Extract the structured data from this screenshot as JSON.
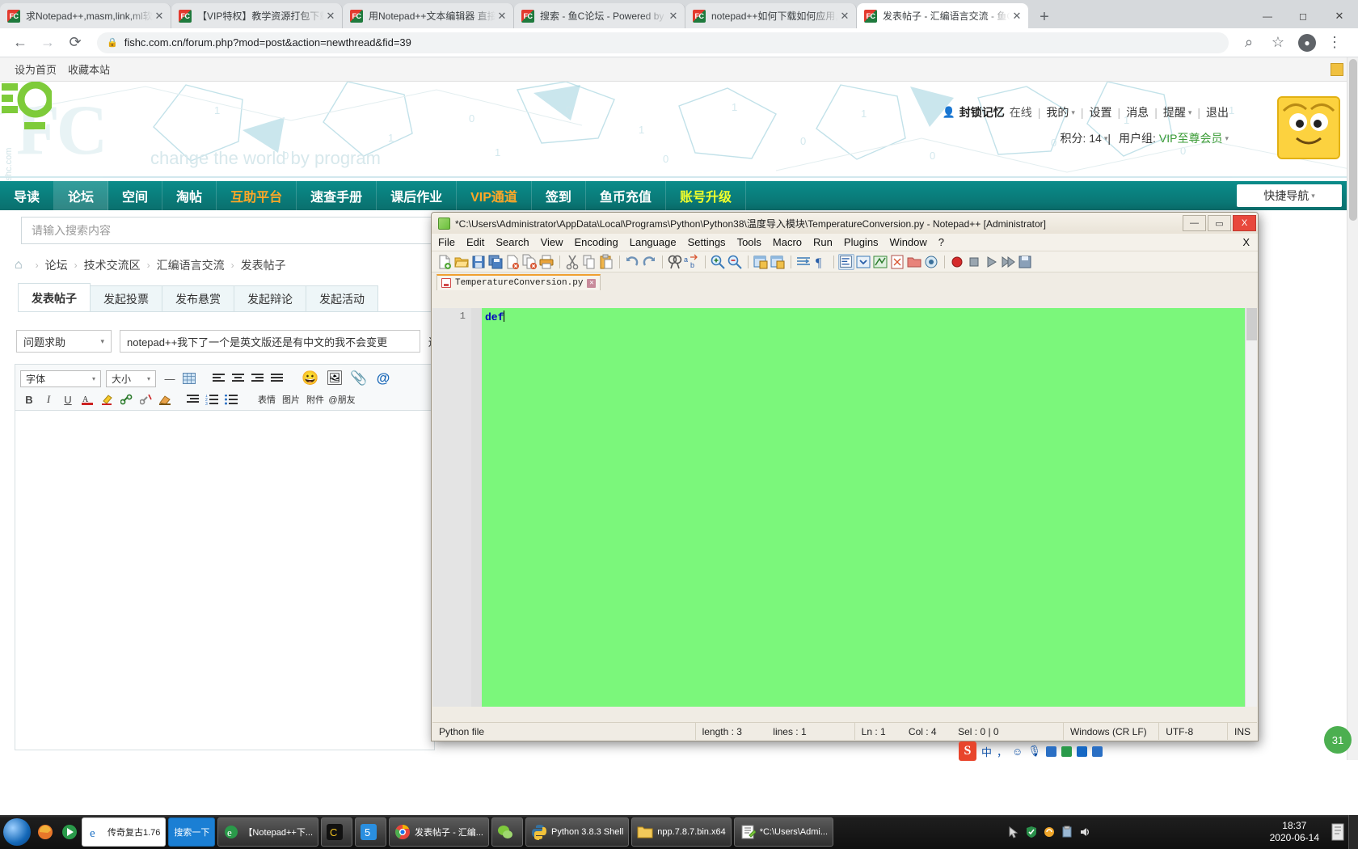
{
  "browser": {
    "tabs": [
      {
        "title": "求Notepad++,masm,link,ml软",
        "active": false
      },
      {
        "title": "【VIP特权】教学资源打包下载地",
        "active": false
      },
      {
        "title": "用Notepad++文本编辑器 直接",
        "active": false
      },
      {
        "title": "搜索 - 鱼C论坛 - Powered by D",
        "active": false
      },
      {
        "title": "notepad++如何下载如何应用,新",
        "active": false
      },
      {
        "title": "发表帖子 - 汇编语言交流 - 鱼C论",
        "active": true
      }
    ],
    "favicon_text": "FC",
    "new_tab_label": "+",
    "close_label": "✕",
    "back_icon": "←",
    "forward_icon": "→",
    "reload_icon": "⟳",
    "lock_icon": "🔒",
    "url": "fishc.com.cn/forum.php?mod=post&action=newthread&fid=39",
    "zoom_icon": "⌕",
    "star_icon": "☆",
    "profile_icon": "👤",
    "menu_icon": "⋮",
    "window_min": "—",
    "window_max": "◻",
    "window_close": "✕"
  },
  "site": {
    "topbar": {
      "set_home": "设为首页",
      "bookmark": "收藏本站"
    },
    "logo": {
      "mark": "FC",
      "tagline": "change the world by program",
      "side_text": "fishc.com"
    },
    "user": {
      "person_icon": "👤",
      "name": "封锁记忆",
      "status": "在线",
      "mine": "我的",
      "settings": "设置",
      "messages": "消息",
      "notices": "提醒",
      "logout": "退出",
      "points_label": "积分: 14",
      "group_label": "用户组:",
      "group_value": "VIP至尊会员"
    },
    "nav": [
      {
        "label": "导读",
        "style": "plain",
        "active": false
      },
      {
        "label": "论坛",
        "style": "plain",
        "active": true
      },
      {
        "label": "空间",
        "style": "plain",
        "active": false
      },
      {
        "label": "淘帖",
        "style": "plain",
        "active": false
      },
      {
        "label": "互助平台",
        "style": "orange",
        "active": false
      },
      {
        "label": "速查手册",
        "style": "plain",
        "active": false
      },
      {
        "label": "课后作业",
        "style": "plain",
        "active": false
      },
      {
        "label": "VIP通道",
        "style": "orange",
        "active": false
      },
      {
        "label": "签到",
        "style": "plain",
        "active": false
      },
      {
        "label": "鱼币充值",
        "style": "plain",
        "active": false
      },
      {
        "label": "账号升级",
        "style": "yellow",
        "active": false
      }
    ],
    "quicknav": "快捷导航",
    "search_placeholder": "请输入搜索内容",
    "search_value": "",
    "breadcrumb": {
      "home_icon": "⌂",
      "items": [
        "论坛",
        "技术交流区",
        "汇编语言交流",
        "发表帖子"
      ],
      "separator": "›"
    },
    "post_tabs": [
      {
        "label": "发表帖子",
        "active": true
      },
      {
        "label": "发起投票",
        "active": false
      },
      {
        "label": "发布悬赏",
        "active": false
      },
      {
        "label": "发起辩论",
        "active": false
      },
      {
        "label": "发起活动",
        "active": false
      }
    ],
    "title_row": {
      "category": "问题求助",
      "title_value": "notepad++我下了一个是英文版还是有中文的我不会变更",
      "trailing": "还"
    },
    "editor_toolbar": {
      "font_label": "字体",
      "size_label": "大小",
      "buttons": [
        {
          "name": "bold",
          "glyph": "B"
        },
        {
          "name": "italic",
          "glyph": "I"
        },
        {
          "name": "underline",
          "glyph": "U"
        }
      ],
      "icons": [
        {
          "name": "smile-icon",
          "glyph": "😀",
          "label": "表情"
        },
        {
          "name": "image-icon",
          "glyph": "🖼",
          "label": "图片"
        },
        {
          "name": "attachment-icon",
          "glyph": "📎",
          "label": "附件"
        },
        {
          "name": "mention-icon",
          "glyph": "@",
          "label": "@朋友"
        }
      ]
    },
    "body_value": ""
  },
  "notepad": {
    "title": "*C:\\Users\\Administrator\\AppData\\Local\\Programs\\Python\\Python38\\温度导入模块\\TemperatureConversion.py - Notepad++ [Administrator]",
    "window_buttons": {
      "min": "—",
      "max": "▭",
      "close": "X"
    },
    "menu": [
      "File",
      "Edit",
      "Search",
      "View",
      "Encoding",
      "Language",
      "Settings",
      "Tools",
      "Macro",
      "Run",
      "Plugins",
      "Window",
      "?"
    ],
    "menu_close": "X",
    "tab_name": "TemperatureConversion.py",
    "tab_close": "✕",
    "line_numbers": [
      "1"
    ],
    "code_lines": [
      "def"
    ],
    "background_color": "#7bf77b",
    "status": {
      "filetype": "Python file",
      "length": "length : 3",
      "lines": "lines : 1",
      "ln": "Ln : 1",
      "col": "Col : 4",
      "sel": "Sel : 0 | 0",
      "eol": "Windows (CR LF)",
      "encoding": "UTF-8",
      "insert": "INS"
    }
  },
  "ime": {
    "logo": "S",
    "mode": "中",
    "punct": "，",
    "face_icon": "☺",
    "mic_icon": "🎤",
    "keyboard_icon": "⌨",
    "tool_icon": "🧰",
    "up_icon": "⬆",
    "grid_icon": "▦"
  },
  "notification": {
    "count": "31"
  },
  "taskbar": {
    "items": [
      {
        "label": "传奇复古1.76",
        "style": "white",
        "icon": "e"
      },
      {
        "label": "搜索一下",
        "style": "blue",
        "icon": ""
      },
      {
        "label": "【Notepad++下...",
        "style": "dark",
        "icon": "e"
      },
      {
        "label": "",
        "style": "dark",
        "icon": "C"
      },
      {
        "label": "",
        "style": "dark",
        "icon": "5"
      },
      {
        "label": "发表帖子 - 汇编...",
        "style": "dark",
        "icon": "chrome"
      },
      {
        "label": "",
        "style": "dark",
        "icon": "wechat"
      },
      {
        "label": "Python 3.8.3 Shell",
        "style": "dark",
        "icon": "py"
      },
      {
        "label": "npp.7.8.7.bin.x64",
        "style": "dark",
        "icon": "folder"
      },
      {
        "label": "*C:\\Users\\Admi...",
        "style": "dark",
        "icon": "npp"
      }
    ],
    "tray": [
      "🖱",
      "🛡",
      "🔄",
      "📋",
      "🔊"
    ],
    "clock_time": "18:37",
    "clock_date": "2020-06-14"
  }
}
